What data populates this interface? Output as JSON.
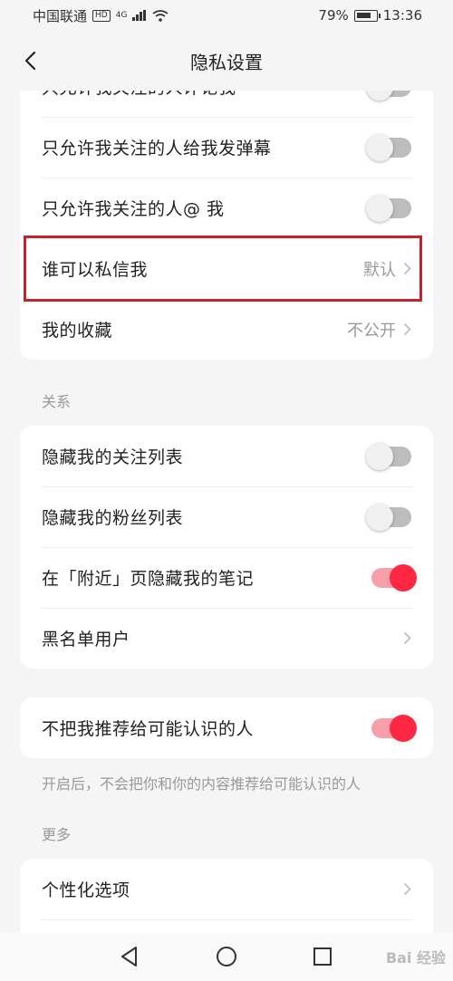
{
  "status_bar": {
    "carrier": "中国联通",
    "hd": "HD",
    "network": "4G",
    "battery": "79%",
    "time": "13:36"
  },
  "header": {
    "title": "隐私设置"
  },
  "sections": {
    "top_card": {
      "rows": [
        {
          "label": "只允许我关注的人评论我",
          "toggle": false
        },
        {
          "label": "只允许我关注的人给我发弹幕",
          "toggle": false
        },
        {
          "label": "只允许我关注的人@ 我",
          "toggle": false
        },
        {
          "label": "谁可以私信我",
          "value": "默认"
        },
        {
          "label": "我的收藏",
          "value": "不公开"
        }
      ]
    },
    "relations": {
      "title": "关系",
      "rows": [
        {
          "label": "隐藏我的关注列表",
          "toggle": false
        },
        {
          "label": "隐藏我的粉丝列表",
          "toggle": false
        },
        {
          "label": "在「附近」页隐藏我的笔记",
          "toggle": true
        },
        {
          "label": "黑名单用户"
        }
      ]
    },
    "recommend": {
      "label": "不把我推荐给可能认识的人",
      "toggle": true,
      "hint": "开启后，不会把你和你的内容推荐给可能认识的人"
    },
    "more": {
      "title": "更多",
      "rows": [
        {
          "label": "个性化选项"
        }
      ]
    }
  },
  "colors": {
    "accent": "#ff2741",
    "highlight": "#c3232d",
    "background": "#f5f5f5"
  },
  "watermark": "Bai 经验"
}
